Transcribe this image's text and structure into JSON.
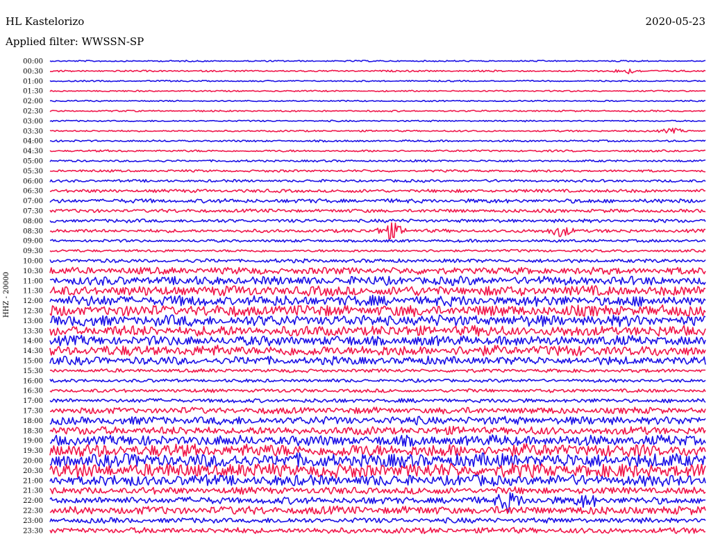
{
  "header": {
    "station": "HL Kastelorizo",
    "date": "2020-05-23",
    "filter": "Applied filter: WWSSN-SP"
  },
  "chart_data": {
    "type": "line",
    "title": "HL Kastelorizo",
    "ylabel": "HHZ - 20000",
    "colors": [
      "#1a10e6",
      "#f0164a"
    ],
    "rows": [
      {
        "label": "00:00",
        "amp": 0.12
      },
      {
        "label": "00:30",
        "amp": 0.14
      },
      {
        "label": "01:00",
        "amp": 0.12
      },
      {
        "label": "01:30",
        "amp": 0.12
      },
      {
        "label": "02:00",
        "amp": 0.12
      },
      {
        "label": "02:30",
        "amp": 0.13
      },
      {
        "label": "03:00",
        "amp": 0.13
      },
      {
        "label": "03:30",
        "amp": 0.14
      },
      {
        "label": "04:00",
        "amp": 0.16
      },
      {
        "label": "04:30",
        "amp": 0.17
      },
      {
        "label": "05:00",
        "amp": 0.18
      },
      {
        "label": "05:30",
        "amp": 0.2
      },
      {
        "label": "06:00",
        "amp": 0.22
      },
      {
        "label": "06:30",
        "amp": 0.28
      },
      {
        "label": "07:00",
        "amp": 0.35
      },
      {
        "label": "07:30",
        "amp": 0.3
      },
      {
        "label": "08:00",
        "amp": 0.3
      },
      {
        "label": "08:30",
        "amp": 0.28
      },
      {
        "label": "09:00",
        "amp": 0.24
      },
      {
        "label": "09:30",
        "amp": 0.22
      },
      {
        "label": "10:00",
        "amp": 0.32
      },
      {
        "label": "10:30",
        "amp": 0.6
      },
      {
        "label": "11:00",
        "amp": 0.75
      },
      {
        "label": "11:30",
        "amp": 0.85
      },
      {
        "label": "12:00",
        "amp": 0.9
      },
      {
        "label": "12:30",
        "amp": 0.95
      },
      {
        "label": "13:00",
        "amp": 0.95
      },
      {
        "label": "13:30",
        "amp": 0.9
      },
      {
        "label": "14:00",
        "amp": 0.85
      },
      {
        "label": "14:30",
        "amp": 0.9
      },
      {
        "label": "15:00",
        "amp": 0.7
      },
      {
        "label": "15:30",
        "amp": 0.3
      },
      {
        "label": "16:00",
        "amp": 0.28
      },
      {
        "label": "16:30",
        "amp": 0.3
      },
      {
        "label": "17:00",
        "amp": 0.35
      },
      {
        "label": "17:30",
        "amp": 0.55
      },
      {
        "label": "18:00",
        "amp": 0.7
      },
      {
        "label": "18:30",
        "amp": 0.7
      },
      {
        "label": "19:00",
        "amp": 0.9
      },
      {
        "label": "19:30",
        "amp": 1.1
      },
      {
        "label": "20:00",
        "amp": 1.2
      },
      {
        "label": "20:30",
        "amp": 1.2
      },
      {
        "label": "21:00",
        "amp": 0.95
      },
      {
        "label": "21:30",
        "amp": 0.6
      },
      {
        "label": "22:00",
        "amp": 0.6
      },
      {
        "label": "22:30",
        "amp": 0.7
      },
      {
        "label": "23:00",
        "amp": 0.45
      },
      {
        "label": "23:30",
        "amp": 0.5
      }
    ],
    "events": [
      {
        "row": 1,
        "t": 0.88,
        "amp": 0.5
      },
      {
        "row": 7,
        "t": 0.95,
        "amp": 0.4
      },
      {
        "row": 17,
        "t": 0.52,
        "amp": 1.6
      },
      {
        "row": 17,
        "t": 0.78,
        "amp": 1.0
      },
      {
        "row": 44,
        "t": 0.7,
        "amp": 1.8
      },
      {
        "row": 44,
        "t": 0.82,
        "amp": 1.0
      }
    ]
  }
}
